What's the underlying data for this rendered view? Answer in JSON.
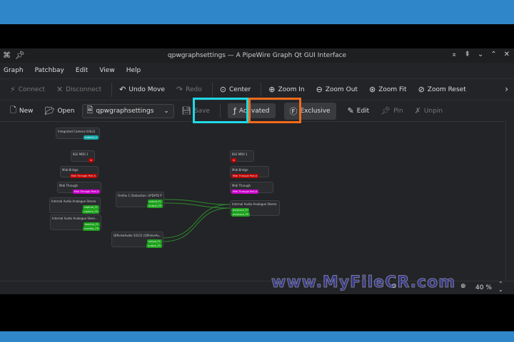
{
  "window": {
    "title": "qpwgraphsettings — A PipeWire Graph Qt GUI Interface"
  },
  "menu": [
    "Graph",
    "Patchbay",
    "Edit",
    "View",
    "Help"
  ],
  "toolbar1": [
    {
      "icon": "connect-icon",
      "glyph": "⚡",
      "label": "Connect",
      "disabled": true
    },
    {
      "icon": "disconnect-icon",
      "glyph": "✕",
      "label": "Disconnect",
      "disabled": true
    },
    {
      "icon": "undo-icon",
      "glyph": "↶",
      "label": "Undo Move",
      "disabled": false
    },
    {
      "icon": "redo-icon",
      "glyph": "↷",
      "label": "Redo",
      "disabled": true
    },
    {
      "icon": "center-icon",
      "glyph": "⊙",
      "label": "Center",
      "disabled": false
    },
    {
      "icon": "zoom-in-icon",
      "glyph": "⊕",
      "label": "Zoom In",
      "disabled": false
    },
    {
      "icon": "zoom-out-icon",
      "glyph": "⊖",
      "label": "Zoom Out",
      "disabled": false
    },
    {
      "icon": "zoom-fit-icon",
      "glyph": "⊛",
      "label": "Zoom Fit",
      "disabled": false
    },
    {
      "icon": "zoom-reset-icon",
      "glyph": "⊘",
      "label": "Zoom Reset",
      "disabled": false
    }
  ],
  "toolbar2": {
    "new": "New",
    "open": "Open",
    "patchbay": "qpwgraphsettings",
    "save": "Save",
    "activated": "Activated",
    "exclusive": "Exclusive",
    "edit": "Edit",
    "pin": "Pin",
    "unpin": "Unpin"
  },
  "nodes": [
    {
      "title": "Integrated Camera (V4L2)",
      "ports": [
        {
          "name": "capture_1",
          "color": "c"
        }
      ]
    },
    {
      "title": "BLE MIDI 1",
      "ports": [
        {
          "name": "in",
          "color": "r"
        }
      ]
    },
    {
      "title": "Midi-Bridge",
      "ports": [
        {
          "name": "Midi Through Port-0",
          "color": "r"
        }
      ]
    },
    {
      "title": "Midi Through",
      "ports": [
        {
          "name": "Midi Through Port-0",
          "color": "m"
        }
      ]
    },
    {
      "title": "Internal Audio Analogue Stereo",
      "ports": [
        {
          "name": "capture_FL",
          "color": "g"
        },
        {
          "name": "capture_FR",
          "color": "g"
        }
      ]
    },
    {
      "title": "Internal Audio Analogue Stere...",
      "ports": [
        {
          "name": "monitor_FL",
          "color": "g"
        },
        {
          "name": "monitor_FR",
          "color": "g"
        }
      ]
    },
    {
      "title": "Firefox 1 [Sebastian: UPDATE Pr...",
      "ports": [
        {
          "name": "output_FL",
          "color": "g"
        },
        {
          "name": "output_FR",
          "color": "g"
        }
      ]
    },
    {
      "title": "QtPulseAudio 54231 [QtPulseAu...",
      "ports": [
        {
          "name": "output_FL",
          "color": "g"
        },
        {
          "name": "output_FR",
          "color": "g"
        }
      ]
    },
    {
      "title": "BLE MIDI 1",
      "ports": [
        {
          "name": "in",
          "color": "r"
        }
      ]
    },
    {
      "title": "Midi-Bridge",
      "ports": [
        {
          "name": "Midi Through Port-0",
          "color": "r"
        }
      ]
    },
    {
      "title": "Midi Through",
      "ports": [
        {
          "name": "Midi Through Port-0",
          "color": "m"
        }
      ]
    },
    {
      "title": "Internal Audio Analogue Stereo",
      "ports": [
        {
          "name": "playback_FL",
          "color": "g"
        },
        {
          "name": "playback_FR",
          "color": "g"
        }
      ]
    }
  ],
  "status": {
    "zoom": "40 %"
  },
  "watermark": "www.MyFileCR.com",
  "colors": {
    "activated_highlight": "#1fd9e6",
    "exclusive_highlight": "#f26a1b",
    "band": "#2f86c8"
  }
}
